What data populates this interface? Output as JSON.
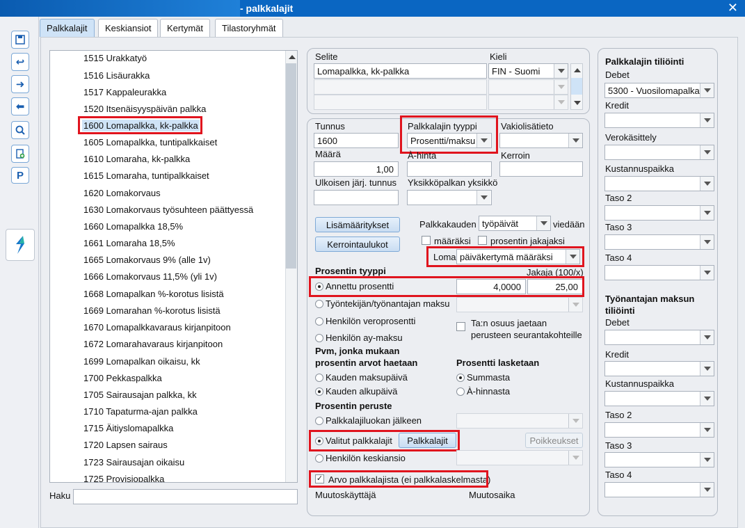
{
  "window": {
    "title": "- palkkalajit"
  },
  "tabs": [
    "Palkkalajit",
    "Keskiansiot",
    "Kertymät",
    "Tilastoryhmät"
  ],
  "list": {
    "items": [
      "1515 Urakkatyö",
      "1516 Lisäurakka",
      "1517 Kappaleurakka",
      "1520 Itsenäisyyspäivän palkka",
      "1600 Lomapalkka, kk-palkka",
      "1605 Lomapalkka, tuntipalkkaiset",
      "1610 Lomaraha, kk-palkka",
      "1615 Lomaraha, tuntipalkkaiset",
      "1620 Lomakorvaus",
      "1630 Lomakorvaus työsuhteen päättyessä",
      "1660 Lomapalkka 18,5%",
      "1661 Lomaraha 18,5%",
      "1665 Lomakorvaus 9% (alle 1v)",
      "1666 Lomakorvaus 11,5% (yli 1v)",
      "1668 Lomapalkan %-korotus lisistä",
      "1669 Lomarahan %-korotus lisistä",
      "1670 Lomapalkkavaraus kirjanpitoon",
      "1672 Lomarahavaraus kirjanpitoon",
      "1699 Lomapalkan oikaisu, kk",
      "1700 Pekkaspalkka",
      "1705 Sairausajan palkka, kk",
      "1710 Tapaturma-ajan palkka",
      "1715 Äitiyslomapalkka",
      "1720 Lapsen sairaus",
      "1723 Sairausajan oikaisu",
      "1725 Provisiopalkka"
    ],
    "search_label": "Haku",
    "search_value": ""
  },
  "selite": {
    "label": "Selite",
    "kieli_label": "Kieli",
    "value": "Lomapalkka, kk-palkka",
    "kieli_value": "FIN - Suomi"
  },
  "details": {
    "tunnus_label": "Tunnus",
    "tunnus_value": "1600",
    "tyyppi_label": "Palkkalajin tyyppi",
    "tyyppi_value": "Prosentti/maksu",
    "vakio_label": "Vakiolisätieto",
    "maara_label": "Määrä",
    "maara_value": "1,00",
    "ahinta_label": "À-hinta",
    "kerroin_label": "Kerroin",
    "ulkoinen_label": "Ulkoisen järj. tunnus",
    "yksikko_label": "Yksikköpalkan yksikkö",
    "lisamaaritykset_label": "Lisämääritykset",
    "kerrointaulukot_label": "Kerrointaulukot",
    "palkkakauden_label": "Palkkakauden",
    "palkkakauden_value": "työpäivät",
    "viedaan_label": "viedään",
    "maaraksi_label": "määräksi",
    "prosentin_jakajaksi_label": "prosentin jakajaksi",
    "loma_label": "Loma",
    "loma_value": "päiväkertymä määräksi",
    "prosentin_tyyppi_label": "Prosentin tyyppi",
    "jakaja_label": "Jakaja (100/x)",
    "annettu_label": "Annettu prosentti",
    "annettu_value": "4,0000",
    "jakaja_value": "25,00",
    "tyontekijan_label": "Työntekijän/työnantajan maksu",
    "veroprosentti_label": "Henkilön veroprosentti",
    "taosuus_label": "Ta:n osuus jaetaan perusteen seurantakohteille",
    "aymaksu_label": "Henkilön ay-maksu",
    "pvm_label": "Pvm, jonka mukaan prosentin arvot haetaan",
    "prosentti_lasketaan_label": "Prosentti lasketaan",
    "kauden_maksupaiva_label": "Kauden maksupäivä",
    "summasta_label": "Summasta",
    "kauden_alkupaiva_label": "Kauden alkupäivä",
    "ahinnasta_label": "À-hinnasta",
    "prosentin_peruste_label": "Prosentin peruste",
    "palkkalajiluokan_label": "Palkkalajiluokan jälkeen",
    "valitut_label": "Valitut palkkalajit",
    "palkkalajit_btn_label": "Palkkalajit",
    "poikkeukset_label": "Poikkeukset",
    "keskiansio_label": "Henkilön keskiansio",
    "arvo_label": "Arvo palkkalajista (ei palkkalaskelmasta)",
    "muutoskayttaja_label": "Muutoskäyttäjä",
    "muutosaika_label": "Muutosaika"
  },
  "tiliointi": {
    "title": "Palkkalajin tiliöinti",
    "debet_label": "Debet",
    "debet_value": "5300 - Vuosilomapalkat",
    "kredit_label": "Kredit",
    "verokasittely_label": "Verokäsittely",
    "kustannuspaikka_label": "Kustannuspaikka",
    "taso2_label": "Taso 2",
    "taso3_label": "Taso 3",
    "taso4_label": "Taso 4"
  },
  "tyonantaja": {
    "title": "Työnantajan maksun tiliöinti",
    "debet_label": "Debet",
    "kredit_label": "Kredit",
    "kustannuspaikka_label": "Kustannuspaikka",
    "taso2_label": "Taso 2",
    "taso3_label": "Taso 3",
    "taso4_label": "Taso 4"
  },
  "toolbar": {
    "p_label": "P"
  }
}
